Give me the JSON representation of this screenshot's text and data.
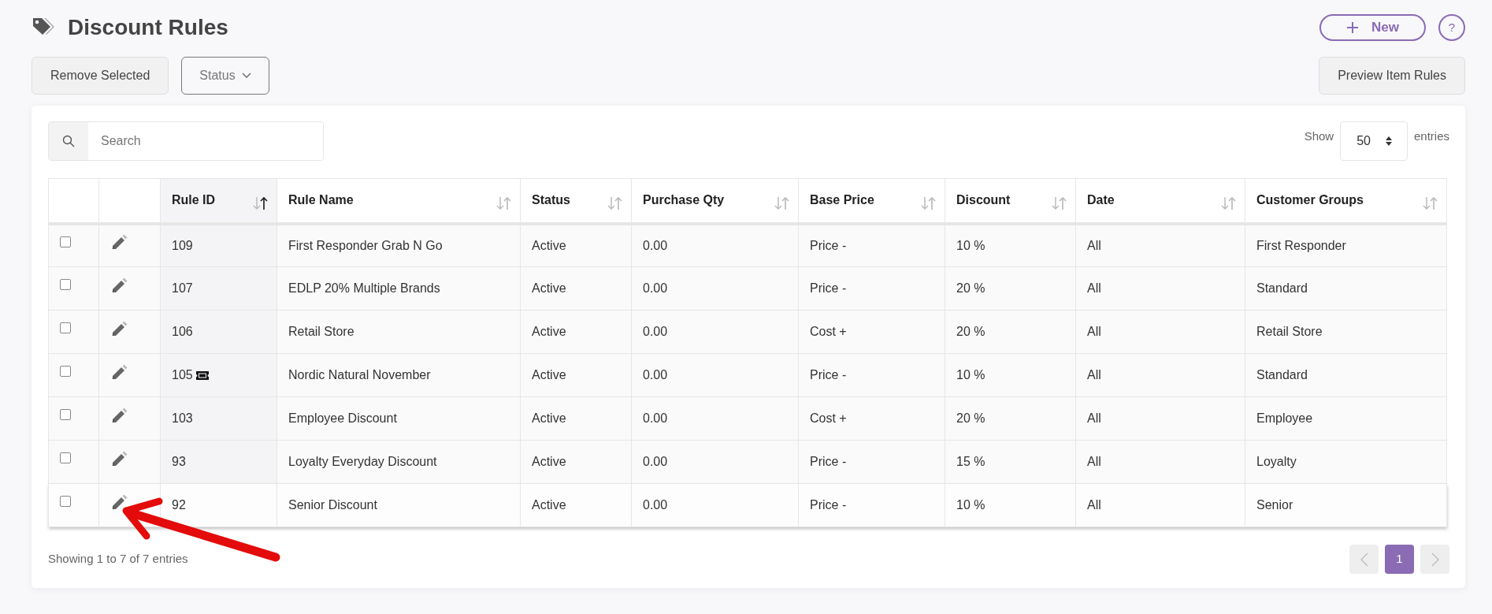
{
  "page": {
    "title": "Discount Rules"
  },
  "header_buttons": {
    "new": "New",
    "help": "?"
  },
  "toolbar": {
    "remove": "Remove Selected",
    "status": "Status",
    "preview": "Preview Item Rules"
  },
  "search": {
    "placeholder": "Search"
  },
  "length": {
    "show": "Show",
    "value": "50",
    "entries": "entries"
  },
  "table": {
    "columns": [
      {
        "label": "Rule ID",
        "sorted": true
      },
      {
        "label": "Rule Name",
        "sorted": false
      },
      {
        "label": "Status",
        "sorted": false
      },
      {
        "label": "Purchase Qty",
        "sorted": false
      },
      {
        "label": "Base Price",
        "sorted": false
      },
      {
        "label": "Discount",
        "sorted": false
      },
      {
        "label": "Date",
        "sorted": false
      },
      {
        "label": "Customer Groups",
        "sorted": false
      }
    ],
    "rows": [
      {
        "checked": false,
        "hovered": false,
        "ticket": false,
        "id": "109",
        "name": "First Responder Grab N Go",
        "status": "Active",
        "qty": "0.00",
        "base": "Price -",
        "discount": "10 %",
        "date": "All",
        "groups": "First Responder"
      },
      {
        "checked": false,
        "hovered": false,
        "ticket": false,
        "id": "107",
        "name": "EDLP 20% Multiple Brands",
        "status": "Active",
        "qty": "0.00",
        "base": "Price -",
        "discount": "20 %",
        "date": "All",
        "groups": "Standard"
      },
      {
        "checked": false,
        "hovered": false,
        "ticket": false,
        "id": "106",
        "name": "Retail Store",
        "status": "Active",
        "qty": "0.00",
        "base": "Cost +",
        "discount": "20 %",
        "date": "All",
        "groups": "Retail Store"
      },
      {
        "checked": false,
        "hovered": false,
        "ticket": true,
        "id": "105",
        "name": "Nordic Natural November",
        "status": "Active",
        "qty": "0.00",
        "base": "Price -",
        "discount": "10 %",
        "date": "All",
        "groups": "Standard"
      },
      {
        "checked": false,
        "hovered": false,
        "ticket": false,
        "id": "103",
        "name": "Employee Discount",
        "status": "Active",
        "qty": "0.00",
        "base": "Cost +",
        "discount": "20 %",
        "date": "All",
        "groups": "Employee"
      },
      {
        "checked": false,
        "hovered": false,
        "ticket": false,
        "id": "93",
        "name": "Loyalty Everyday Discount",
        "status": "Active",
        "qty": "0.00",
        "base": "Price -",
        "discount": "15 %",
        "date": "All",
        "groups": "Loyalty"
      },
      {
        "checked": false,
        "hovered": true,
        "ticket": false,
        "id": "92",
        "name": "Senior Discount",
        "status": "Active",
        "qty": "0.00",
        "base": "Price -",
        "discount": "10 %",
        "date": "All",
        "groups": "Senior"
      }
    ]
  },
  "info": "Showing 1 to 7 of 7 entries",
  "pagination": {
    "prev_disabled": true,
    "next_disabled": true,
    "pages": [
      {
        "label": "1",
        "selected": true
      }
    ]
  },
  "annotation": {
    "arrow": true
  }
}
